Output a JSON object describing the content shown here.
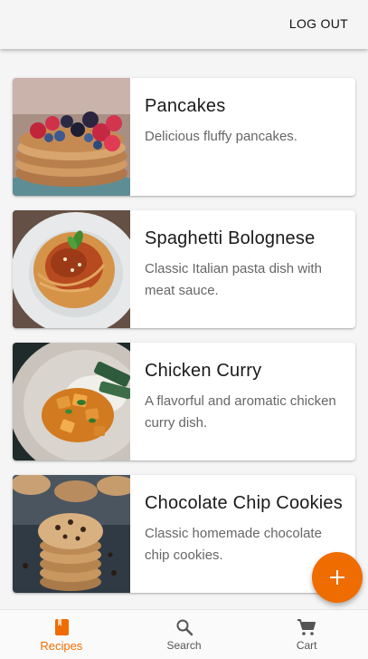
{
  "header": {
    "logout_label": "LOG OUT"
  },
  "theme": {
    "accent": "#ef6c00",
    "background": "#f5f5f5"
  },
  "recipes": [
    {
      "title": "Pancakes",
      "description": "Delicious fluffy pancakes.",
      "image": "pancakes-photo"
    },
    {
      "title": "Spaghetti Bolognese",
      "description": "Classic Italian pasta dish with meat sauce.",
      "image": "spaghetti-photo"
    },
    {
      "title": "Chicken Curry",
      "description": "A flavorful and aromatic chicken curry dish.",
      "image": "curry-photo"
    },
    {
      "title": "Chocolate Chip Cookies",
      "description": "Classic homemade chocolate chip cookies.",
      "image": "cookies-photo"
    }
  ],
  "fab": {
    "icon": "plus-icon"
  },
  "bottom_nav": {
    "items": [
      {
        "label": "Recipes",
        "icon": "book-icon",
        "active": true
      },
      {
        "label": "Search",
        "icon": "search-icon",
        "active": false
      },
      {
        "label": "Cart",
        "icon": "cart-icon",
        "active": false
      }
    ]
  }
}
